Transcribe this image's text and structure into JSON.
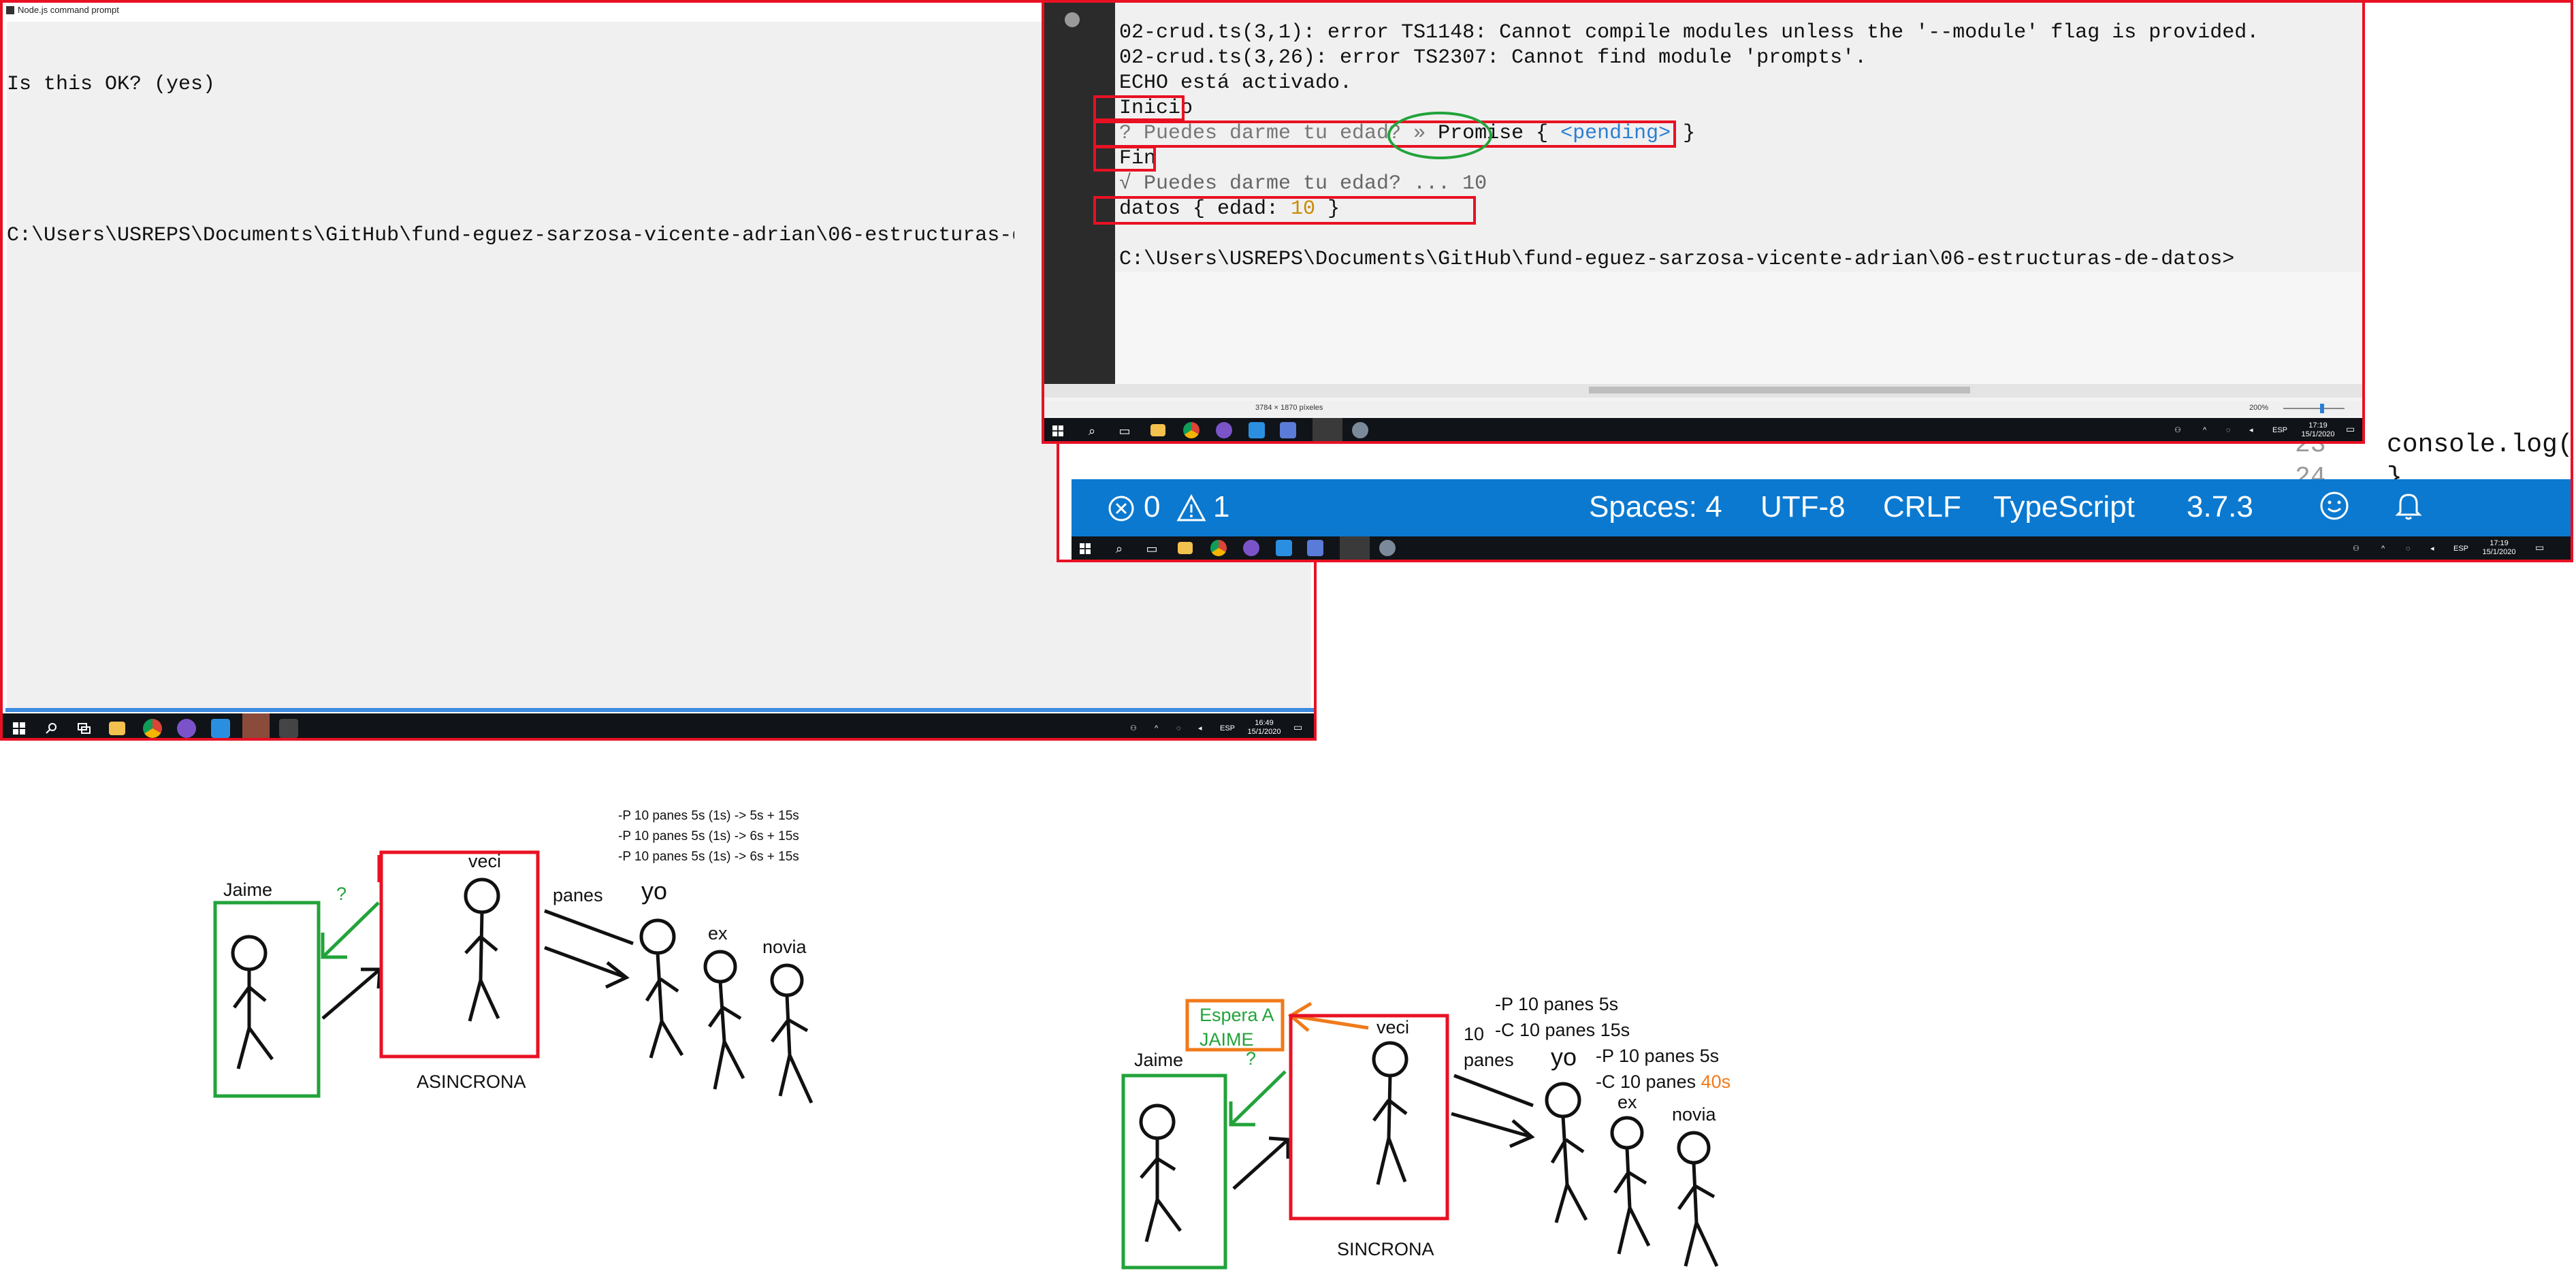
{
  "window1": {
    "title": "Node.js command prompt",
    "lines": [
      "Is this OK? (yes)",
      "",
      "C:\\Users\\USREPS\\Documents\\GitHub\\fund-eguez-sarzosa-vicente-adrian\\06-estructuras-de-d"
    ],
    "taskbar": {
      "lang": "ESP",
      "time": "16:49",
      "date": "15/1/2020"
    }
  },
  "window2": {
    "code_lines": [
      "console.log('Fin');",
      "}"
    ],
    "line_numbers": [
      "23",
      "24"
    ],
    "status": {
      "errors": "0",
      "warnings": "1",
      "spaces": "Spaces: 4",
      "encoding": "UTF-8",
      "eol": "CRLF",
      "language": "TypeScript",
      "version": "3.7.3"
    },
    "taskbar": {
      "lang": "ESP",
      "time": "17:19",
      "date": "15/1/2020"
    }
  },
  "window3": {
    "terminal_lines": [
      "02-crud.ts(3,1): error TS1148: Cannot compile modules unless the '--module' flag is provided.",
      "02-crud.ts(3,26): error TS2307: Cannot find module 'prompts'.",
      "ECHO está activado.",
      "Inicio",
      "? Puedes darme tu edad? » ",
      "Fin",
      "√ Puedes darme tu edad? ... 10",
      "datos { edad: ",
      "",
      "C:\\Users\\USREPS\\Documents\\GitHub\\fund-eguez-sarzosa-vicente-adrian\\06-estructuras-de-datos>"
    ],
    "promise_word": "Promise",
    "pending_open": "{ ",
    "pending_word": "<pending>",
    "pending_close": " }",
    "edad_value": "10",
    "edad_close": " }",
    "image_info": "3784 × 1870 píxeles",
    "zoom": "200%",
    "taskbar": {
      "lang": "ESP",
      "time": "17:19",
      "date": "15/1/2020"
    }
  },
  "drawing_async": {
    "jaime_label": "Jaime",
    "question": "?",
    "veci_label": "veci",
    "panes_label": "panes",
    "yo_label": "yo",
    "ex_label": "ex",
    "novia_label": "novia",
    "caption": "ASINCRONA",
    "notes": [
      "-P 10 panes 5s (1s) -> 5s  + 15s",
      "-P 10 panes 5s (1s) -> 6s + 15s",
      "-P 10 panes 5s (1s) -> 6s + 15s"
    ]
  },
  "drawing_sync": {
    "jaime_label": "Jaime",
    "question": "?",
    "espera_line1": "Espera A",
    "espera_line2": "JAIME",
    "veci_label": "veci",
    "panes_line1": "10",
    "panes_line2": "panes",
    "yo_label": "yo",
    "ex_label": "ex",
    "novia_label": "novia",
    "caption": "SINCRONA",
    "notes_top": [
      "-P 10 panes 5s",
      "-C 10 panes 15s"
    ],
    "notes_mid": [
      "-P 10 panes 5s",
      "-C 10 panes "
    ],
    "notes_mid_highlight": "40s"
  },
  "colors": {
    "red": "#e81123",
    "green": "#22a33a",
    "orange": "#f07a1a",
    "vscode_blue": "#0b79d0",
    "taskbar": "#101318",
    "ts_blue": "#2a7fd4",
    "number_orange": "#c98a00"
  }
}
